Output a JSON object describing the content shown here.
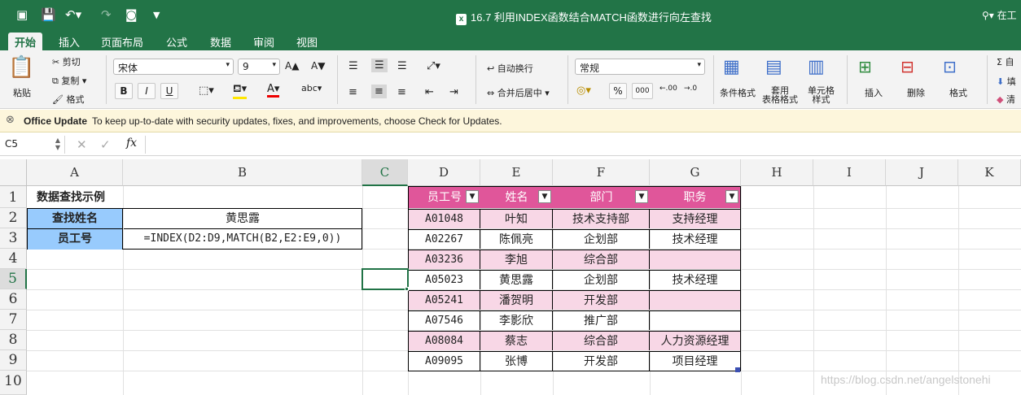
{
  "window": {
    "title": "16.7 利用INDEX函数结合MATCH函数进行向左查找",
    "search_placeholder": "在工",
    "accent": "#227447"
  },
  "ribbon_tabs": [
    "开始",
    "插入",
    "页面布局",
    "公式",
    "数据",
    "审阅",
    "视图"
  ],
  "ribbon": {
    "paste": "粘贴",
    "cut": "剪切",
    "copy": "复制",
    "format_painter": "格式",
    "font_name": "宋体",
    "font_size": "9",
    "bold": "B",
    "italic": "I",
    "underline": "U",
    "wrap_text": "自动换行",
    "merge_center": "合并后居中",
    "number_format": "常规",
    "percent": "%",
    "thousands": "000",
    "inc_decimal": ".00",
    "dec_decimal": ".0",
    "conditional_format": "条件格式",
    "table_format": "套用\n表格格式",
    "cell_style": "单元格\n样式",
    "insert": "插入",
    "delete": "删除",
    "format": "格式",
    "autosum": "自",
    "fill": "填",
    "clear": "清"
  },
  "update_bar": {
    "title": "Office Update",
    "message": "To keep up-to-date with security updates, fixes, and improvements, choose Check for Updates."
  },
  "formula_bar": {
    "name_box": "C5",
    "fx": "fx",
    "content": ""
  },
  "columns": [
    "A",
    "B",
    "C",
    "D",
    "E",
    "F",
    "G",
    "H",
    "I",
    "J",
    "K"
  ],
  "rows": [
    "1",
    "2",
    "3",
    "4",
    "5",
    "6",
    "7",
    "8",
    "9",
    "10"
  ],
  "sheet": {
    "a1": "数据查找示例",
    "a2": "查找姓名",
    "b2": "黄思露",
    "a3": "员工号",
    "b3": "=INDEX(D2:D9,MATCH(B2,E2:E9,0))",
    "table_headers": [
      "员工号",
      "姓名",
      "部门",
      "职务"
    ],
    "table_rows": [
      [
        "A01048",
        "叶知",
        "技术支持部",
        "支持经理"
      ],
      [
        "A02267",
        "陈佩亮",
        "企划部",
        "技术经理"
      ],
      [
        "A03236",
        "李旭",
        "综合部",
        ""
      ],
      [
        "A05023",
        "黄思露",
        "企划部",
        "技术经理"
      ],
      [
        "A05241",
        "潘贺明",
        "开发部",
        ""
      ],
      [
        "A07546",
        "李影欣",
        "推广部",
        ""
      ],
      [
        "A08084",
        "蔡志",
        "综合部",
        "人力资源经理"
      ],
      [
        "A09095",
        "张博",
        "开发部",
        "项目经理"
      ]
    ]
  },
  "watermark": "https://blog.csdn.net/angelstonehi"
}
